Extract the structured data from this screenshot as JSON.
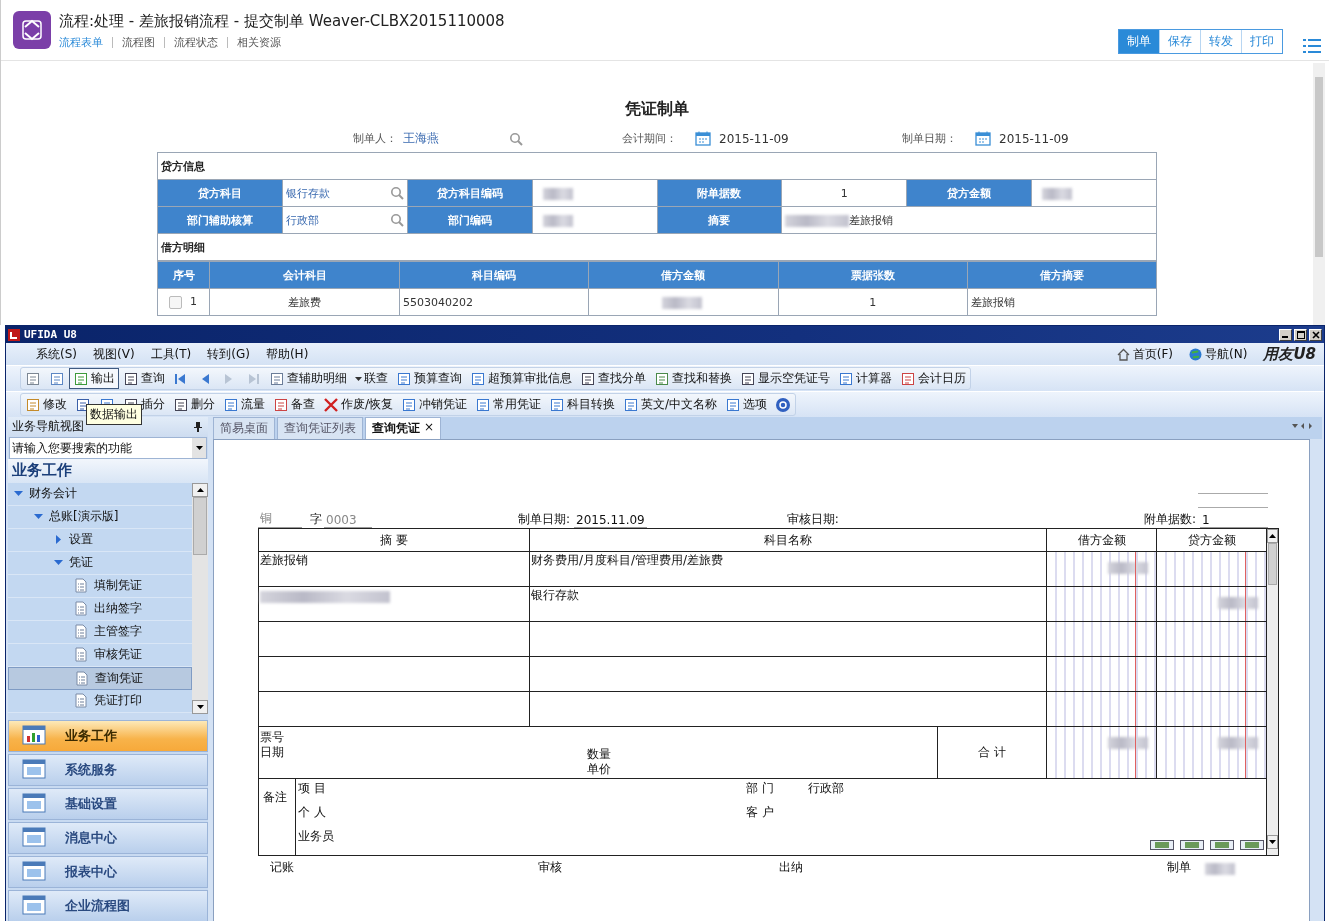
{
  "header": {
    "title": "流程:处理 - 差旅报销流程 - 提交制单 Weaver-CLBX2015110008",
    "tabs": [
      {
        "label": "流程表单",
        "selected": true
      },
      {
        "label": "流程图",
        "selected": false
      },
      {
        "label": "流程状态",
        "selected": false
      },
      {
        "label": "相关资源",
        "selected": false
      }
    ],
    "actions": [
      {
        "label": "制单",
        "selected": true
      },
      {
        "label": "保存",
        "selected": false
      },
      {
        "label": "转发",
        "selected": false
      },
      {
        "label": "打印",
        "selected": false
      }
    ]
  },
  "form": {
    "title": "凭证制单",
    "meta": [
      {
        "label": "制单人：",
        "value": "王海燕",
        "kind": "lookup"
      },
      {
        "label": "会计期间：",
        "value": "2015-11-09",
        "kind": "date"
      },
      {
        "label": "制单日期：",
        "value": "2015-11-09",
        "kind": "date"
      }
    ],
    "credit": {
      "title": "贷方信息",
      "rows": [
        [
          {
            "label": "贷方科目",
            "value": "银行存款",
            "kind": "lookup"
          },
          {
            "label": "贷方科目编码",
            "kind": "redacted"
          },
          {
            "label": "附单据数",
            "value": "1",
            "kind": "plain"
          },
          {
            "label": "贷方金额",
            "kind": "redacted"
          }
        ],
        [
          {
            "label": "部门辅助核算",
            "value": "行政部",
            "kind": "lookup"
          },
          {
            "label": "部门编码",
            "kind": "redacted"
          },
          {
            "label": "摘要",
            "value": "差旅报销",
            "kind": "redacted-prefix"
          }
        ]
      ]
    },
    "debit": {
      "title": "借方明细",
      "columns": [
        "序号",
        "会计科目",
        "科目编码",
        "借方金额",
        "票据张数",
        "借方摘要"
      ],
      "rows": [
        {
          "checked": false,
          "cells": [
            {
              "kind": "text",
              "text": "1"
            },
            {
              "kind": "text",
              "text": "差旅费"
            },
            {
              "kind": "text",
              "text": "5503040202"
            },
            {
              "kind": "redacted"
            },
            {
              "kind": "text",
              "text": "1"
            },
            {
              "kind": "text",
              "text": "差旅报销"
            }
          ]
        }
      ]
    }
  },
  "u8": {
    "title": "UFIDA U8",
    "menu": [
      "系统(S)",
      "视图(V)",
      "工具(T)",
      "转到(G)",
      "帮助(H)"
    ],
    "links": [
      "首页(F)",
      "导航(N)"
    ],
    "brand": "用友U8",
    "toolbar1": [
      {
        "pressed": false
      },
      {
        "pressed": false
      },
      {
        "label": "输出",
        "pressed": true
      },
      {
        "label": "查询",
        "pressed": false
      },
      {
        "pressed": false
      },
      {
        "pressed": false
      },
      {
        "pressed": false
      },
      {
        "pressed": false
      },
      {
        "label": "查辅助明细",
        "pressed": false
      },
      {
        "label": "联查",
        "pressed": false
      },
      {
        "label": "预算查询",
        "pressed": false
      },
      {
        "label": "超预算审批信息",
        "pressed": false
      },
      {
        "label": "查找分单",
        "pressed": false
      },
      {
        "label": "查找和替换",
        "pressed": false
      },
      {
        "label": "显示空凭证号",
        "pressed": false
      },
      {
        "label": "计算器",
        "pressed": false
      },
      {
        "label": "会计日历",
        "pressed": false
      }
    ],
    "toolbar2": [
      {
        "label": "修改",
        "pressed": false
      },
      {
        "pressed": false
      },
      {
        "pressed": false
      },
      {
        "label": "插分",
        "pressed": false
      },
      {
        "label": "删分",
        "pressed": false
      },
      {
        "label": "流量",
        "pressed": false
      },
      {
        "label": "备查",
        "pressed": false
      },
      {
        "label": "作废/恢复",
        "pressed": false
      },
      {
        "label": "冲销凭证",
        "pressed": false
      },
      {
        "label": "常用凭证",
        "pressed": false
      },
      {
        "label": "科目转换",
        "pressed": false
      },
      {
        "label": "英文/中文名称",
        "pressed": false
      },
      {
        "label": "选项",
        "pressed": false
      },
      {
        "pressed": false
      }
    ],
    "tooltip": "数据输出",
    "nav": {
      "title": "业务导航视图",
      "search_placeholder": "请输入您要搜索的功能",
      "section": "业务工作",
      "tree": [
        {
          "label": "财务会计",
          "expanded": true,
          "selected": false,
          "children": [
            {
              "label": "总账[演示版]",
              "expanded": true,
              "selected": false,
              "children": [
                {
                  "label": "设置",
                  "expanded": false,
                  "selected": false
                },
                {
                  "label": "凭证",
                  "expanded": true,
                  "selected": false,
                  "children": [
                    {
                      "label": "填制凭证",
                      "selected": false
                    },
                    {
                      "label": "出纳签字",
                      "selected": false
                    },
                    {
                      "label": "主管签字",
                      "selected": false
                    },
                    {
                      "label": "审核凭证",
                      "selected": false
                    },
                    {
                      "label": "查询凭证",
                      "selected": true
                    },
                    {
                      "label": "凭证打印",
                      "selected": false
                    }
                  ]
                }
              ]
            }
          ]
        }
      ],
      "modules": [
        {
          "label": "业务工作",
          "selected": true
        },
        {
          "label": "系统服务",
          "selected": false
        },
        {
          "label": "基础设置",
          "selected": false
        },
        {
          "label": "消息中心",
          "selected": false
        },
        {
          "label": "报表中心",
          "selected": false
        },
        {
          "label": "企业流程图",
          "selected": false
        }
      ]
    },
    "tabs": [
      {
        "label": "简易桌面",
        "selected": false
      },
      {
        "label": "查询凭证列表",
        "selected": false
      },
      {
        "label": "查询凭证",
        "selected": true,
        "close": "×"
      }
    ],
    "voucher": {
      "type": "铜",
      "type_suffix": "字",
      "number": "0003",
      "date_label": "制单日期:",
      "date": "2015.11.09",
      "audit_label": "审核日期:",
      "attach_label": "附单据数:",
      "attach": "1",
      "columns": [
        "摘 要",
        "科目名称",
        "借方金额",
        "贷方金额"
      ],
      "rows": [
        {
          "summary": "差旅报销",
          "account": "财务费用/月度科目/管理费用/差旅费",
          "has_debit": true,
          "has_credit": false
        },
        {
          "summary_hidden": true,
          "account": "银行存款",
          "has_debit": false,
          "has_credit": true
        }
      ],
      "ticket_label": "票号",
      "date2_label": "日期",
      "qty_label": "数量",
      "price_label": "单价",
      "total_label": "合 计",
      "remark_label": "备注",
      "project_label": "项 目",
      "dept_label": "部 门",
      "dept": "行政部",
      "person_label": "个 人",
      "customer_label": "客 户",
      "clerk_label": "业务员",
      "signatures": [
        "记账",
        "审核",
        "出纳",
        "制单"
      ]
    }
  }
}
